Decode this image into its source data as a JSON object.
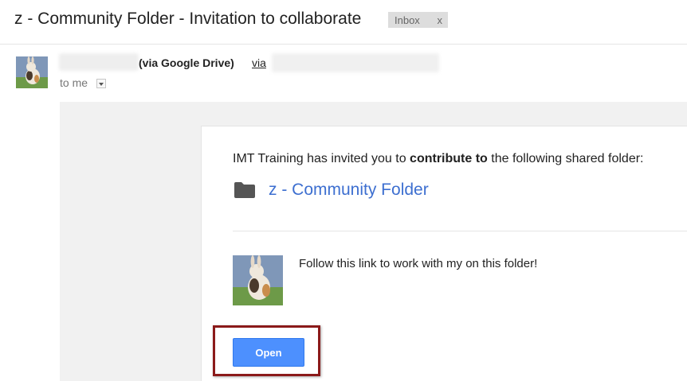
{
  "email": {
    "subject": "z - Community Folder - Invitation to collaborate",
    "label_badge": {
      "text": "Inbox",
      "remove": "x"
    },
    "sender": {
      "via_service": "(via Google Drive)",
      "via_link": "via",
      "recipient": "to me"
    }
  },
  "body": {
    "invite_prefix": "IMT Training has invited you to ",
    "invite_bold": "contribute to",
    "invite_suffix": " the following shared folder:",
    "folder_name": "z - Community Folder",
    "message": "Follow this link to work with my on this folder!",
    "open_button": "Open"
  },
  "colors": {
    "link": "#3d6fd0",
    "button": "#4d90fe",
    "highlight_border": "#8b1a1a"
  },
  "icons": [
    "folder-icon",
    "dropdown-arrow-icon"
  ]
}
